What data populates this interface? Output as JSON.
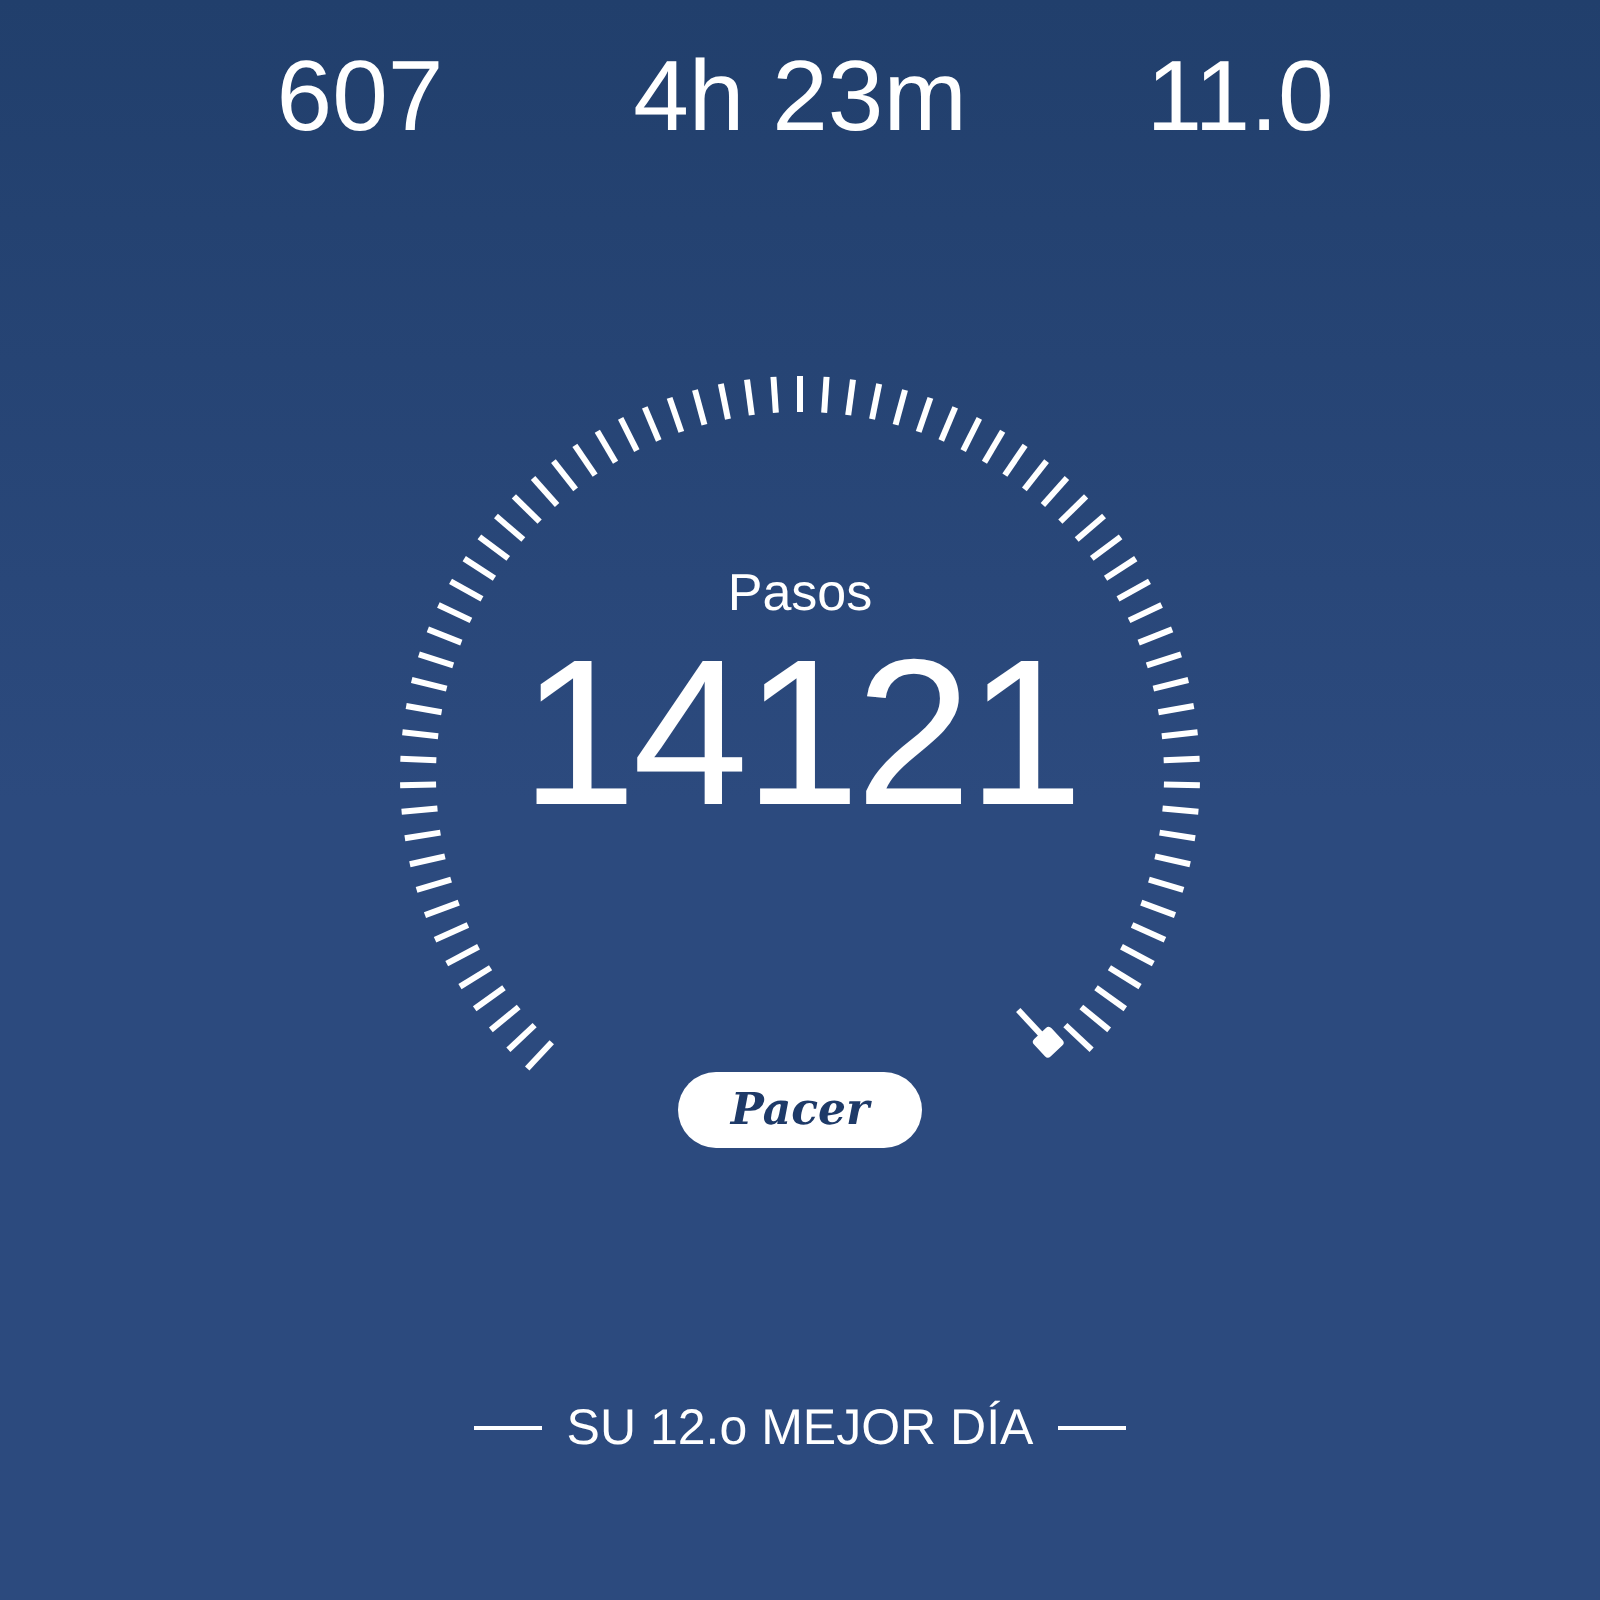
{
  "stats": [
    {
      "value": "607"
    },
    {
      "value": "4h 23m"
    },
    {
      "value": "11.0"
    }
  ],
  "gauge": {
    "label": "Pasos",
    "value": "14121"
  },
  "badge": {
    "text": "Pacer"
  },
  "footer": {
    "text": "SU 12.o MEJOR DÍA"
  }
}
